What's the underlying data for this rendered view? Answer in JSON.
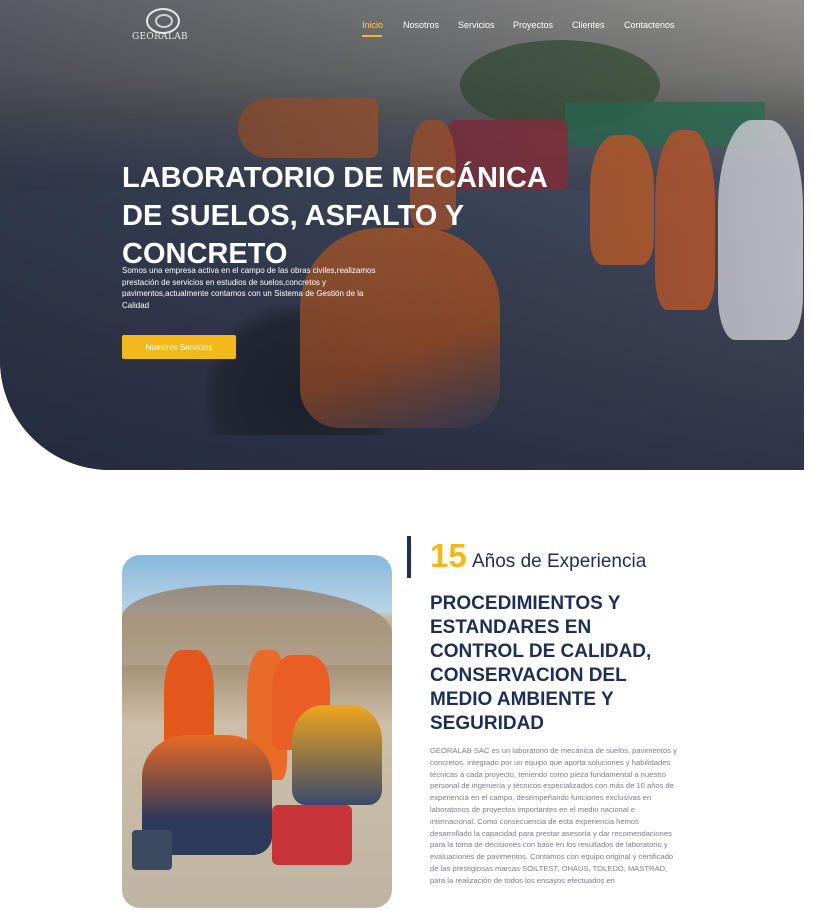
{
  "brand": {
    "logo_text": "GEORALAB"
  },
  "nav": {
    "items": [
      {
        "label": "Inicio",
        "active": true
      },
      {
        "label": "Nosotros",
        "active": false
      },
      {
        "label": "Servicios",
        "active": false
      },
      {
        "label": "Proyectos",
        "active": false
      },
      {
        "label": "Clientes",
        "active": false
      },
      {
        "label": "Contactenos",
        "active": false
      }
    ],
    "active_color": "#ffd04a"
  },
  "hero": {
    "title_lines": [
      "LABORATORIO DE MECÁNICA",
      "DE SUELOS, ASFALTO Y",
      "CONCRETO"
    ],
    "description": "Somos una empresa activa en el campo de las obras civiles,realizamos prestación de servicios en estudios de suelos,concretos y pavimentos,actualmente contamos con un Sistema de Gestión de la Calidad",
    "button_label": "Nuestros Servicios"
  },
  "about": {
    "years_number": "15",
    "years_text": "Años de Experiencia",
    "title_lines": [
      "PROCEDIMIENTOS Y",
      "ESTANDARES EN",
      "CONTROL DE CALIDAD,",
      "CONSERVACION DEL",
      "MEDIO AMBIENTE Y",
      "SEGURIDAD"
    ],
    "paragraph": "GEORALAB SAC es un laboratorio de mecánica de suelos, pavimentos y concretos, integrado por un equipo que aporta soluciones y habilidades técnicas a cada proyecto, teniendo como pieza fundamental a nuestro personal de ingeniería y técnicos especializados con más de 10 años de experiencia en el campo, desempeñando funciones exclusivas en laboratorios de proyectos importantes en el medio nacional e internacional. Como consecuencia de esta experiencia hemos desarrollado la capacidad para prestar asesoría y dar recomendaciones para la toma de decisiones con base en los resultados de laboratorio y evaluaciones de pavimentos. Contamos con equipo original y certificado de las prestigiosas marcas SOILTEST, OHAUS, TOLEDO, MASTRAD, para la realización de todos los ensayos efectuados en"
  },
  "colors": {
    "accent": "#f5b81c",
    "navy": "#1d2f58",
    "body_text": "#7d7d86"
  }
}
